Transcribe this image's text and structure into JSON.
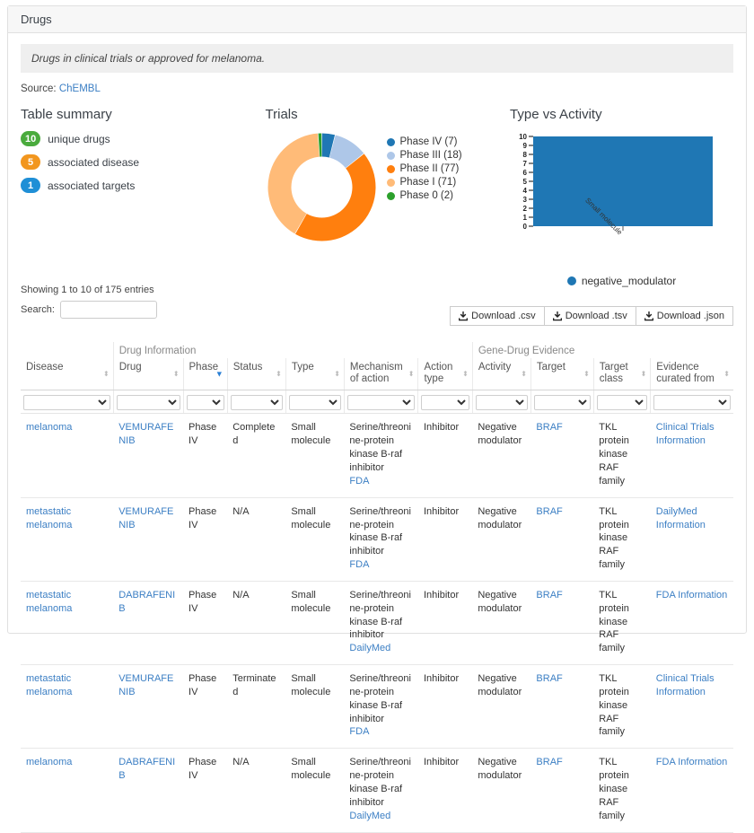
{
  "panel": {
    "title": "Drugs"
  },
  "description": "Drugs in clinical trials or approved for melanoma.",
  "source": {
    "label": "Source:",
    "link_text": "ChEMBL"
  },
  "summary": {
    "title": "Table summary",
    "items": [
      {
        "count": "10",
        "label": "unique drugs",
        "color": "#4aab3d"
      },
      {
        "count": "5",
        "label": "associated disease",
        "color": "#f2961e"
      },
      {
        "count": "1",
        "label": "associated targets",
        "color": "#1f8fd6"
      }
    ]
  },
  "trials": {
    "title": "Trials"
  },
  "type_vs_activity": {
    "title": "Type vs Activity"
  },
  "chart_data": [
    {
      "type": "pie",
      "title": "Trials",
      "donut": true,
      "legend_position": "right",
      "categories": [
        "Phase IV",
        "Phase III",
        "Phase II",
        "Phase I",
        "Phase 0"
      ],
      "values": [
        7,
        18,
        77,
        71,
        2
      ],
      "labels": [
        "Phase IV (7)",
        "Phase III (18)",
        "Phase II (77)",
        "Phase I (71)",
        "Phase 0 (2)"
      ],
      "colors": [
        "#1f77b4",
        "#aec7e8",
        "#ff7f0e",
        "#ffbb78",
        "#2ca02c"
      ]
    },
    {
      "type": "bar",
      "title": "Type vs Activity",
      "categories": [
        "Small molecule"
      ],
      "series": [
        {
          "name": "negative_modulator",
          "values": [
            10
          ],
          "color": "#1f77b4"
        }
      ],
      "xlabel": "",
      "ylabel": "",
      "ylim": [
        0,
        10
      ],
      "yticks": [
        "10",
        "9",
        "8",
        "7",
        "6",
        "5",
        "4",
        "3",
        "2",
        "1",
        "0"
      ],
      "grid": false,
      "legend_position": "bottom",
      "legend": [
        "negative_modulator"
      ]
    }
  ],
  "table_controls": {
    "showing": "Showing 1 to 10 of 175 entries",
    "search_label": "Search:",
    "search_value": "",
    "search_placeholder": "",
    "downloads": [
      {
        "label": "Download .csv"
      },
      {
        "label": "Download .tsv"
      },
      {
        "label": "Download .json"
      }
    ]
  },
  "table": {
    "group_headers": [
      {
        "label": "",
        "span": 1
      },
      {
        "label": "Drug Information",
        "span": 4
      },
      {
        "label": "",
        "span": 2
      },
      {
        "label": "Gene-Drug Evidence",
        "span": 4
      }
    ],
    "columns": [
      {
        "label": "Disease",
        "sort": "none"
      },
      {
        "label": "Drug",
        "sort": "none"
      },
      {
        "label": "Phase",
        "sort": "desc"
      },
      {
        "label": "Status",
        "sort": "none"
      },
      {
        "label": "Type",
        "sort": "none"
      },
      {
        "label": "Mechanism of action",
        "sort": "none"
      },
      {
        "label": "Action type",
        "sort": "none"
      },
      {
        "label": "Activity",
        "sort": "none"
      },
      {
        "label": "Target",
        "sort": "none"
      },
      {
        "label": "Target class",
        "sort": "none"
      },
      {
        "label": "Evidence curated from",
        "sort": "none"
      }
    ],
    "filter_values": [
      "",
      "",
      "",
      "",
      "",
      "",
      "",
      "",
      "",
      "",
      ""
    ],
    "rows": [
      {
        "disease": "melanoma",
        "drug": "VEMURAFENIB",
        "phase": "Phase IV",
        "status": "Completed",
        "type": "Small molecule",
        "moa": "Serine/threonine-protein kinase B-raf inhibitor",
        "moa_link": "FDA",
        "action_type": "Inhibitor",
        "activity": "Negative modulator",
        "target": "BRAF",
        "target_class": "TKL protein kinase RAF family",
        "evidence": "Clinical Trials Information"
      },
      {
        "disease": "metastatic melanoma",
        "drug": "VEMURAFENIB",
        "phase": "Phase IV",
        "status": "N/A",
        "type": "Small molecule",
        "moa": "Serine/threonine-protein kinase B-raf inhibitor",
        "moa_link": "FDA",
        "action_type": "Inhibitor",
        "activity": "Negative modulator",
        "target": "BRAF",
        "target_class": "TKL protein kinase RAF family",
        "evidence": "DailyMed Information"
      },
      {
        "disease": "metastatic melanoma",
        "drug": "DABRAFENIB",
        "phase": "Phase IV",
        "status": "N/A",
        "type": "Small molecule",
        "moa": "Serine/threonine-protein kinase B-raf inhibitor",
        "moa_link": "DailyMed",
        "action_type": "Inhibitor",
        "activity": "Negative modulator",
        "target": "BRAF",
        "target_class": "TKL protein kinase RAF family",
        "evidence": "FDA Information"
      },
      {
        "disease": "metastatic melanoma",
        "drug": "VEMURAFENIB",
        "phase": "Phase IV",
        "status": "Terminated",
        "type": "Small molecule",
        "moa": "Serine/threonine-protein kinase B-raf inhibitor",
        "moa_link": "FDA",
        "action_type": "Inhibitor",
        "activity": "Negative modulator",
        "target": "BRAF",
        "target_class": "TKL protein kinase RAF family",
        "evidence": "Clinical Trials Information"
      },
      {
        "disease": "melanoma",
        "drug": "DABRAFENIB",
        "phase": "Phase IV",
        "status": "N/A",
        "type": "Small molecule",
        "moa": "Serine/threonine-protein kinase B-raf inhibitor",
        "moa_link": "DailyMed",
        "action_type": "Inhibitor",
        "activity": "Negative modulator",
        "target": "BRAF",
        "target_class": "TKL protein kinase RAF family",
        "evidence": "FDA Information"
      }
    ]
  }
}
